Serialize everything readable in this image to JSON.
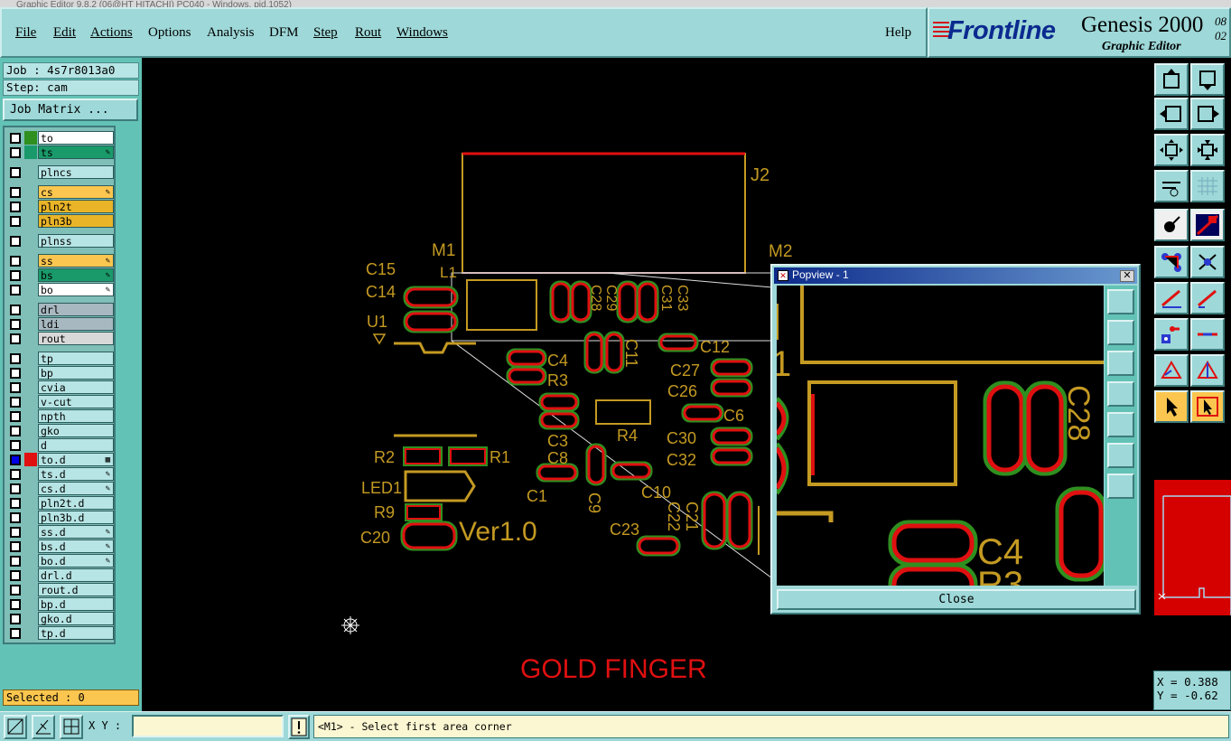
{
  "titlebar": {
    "text": "Graphic Editor 9.8.2 (06@HT HITACHI) PC040 - Windows, pid.1052)"
  },
  "menu": {
    "file": "File",
    "edit": "Edit",
    "actions": "Actions",
    "options": "Options",
    "analysis": "Analysis",
    "dfm": "DFM",
    "step": "Step",
    "rout": "Rout",
    "windows": "Windows",
    "help": "Help"
  },
  "brand": {
    "logo": "Frontline",
    "product": "Genesis 2000",
    "subtitle": "Graphic Editor",
    "version": "08 02"
  },
  "left": {
    "job": "Job : 4s7r8013a0",
    "step": "Step: cam",
    "job_matrix": "Job Matrix ...",
    "selected": "Selected : 0"
  },
  "layers": [
    {
      "name": "to",
      "color": "#2f8f1f",
      "bg": "#ffffff",
      "flag": ""
    },
    {
      "name": "ts",
      "color": "#1a9a6a",
      "bg": "#1a9a6a",
      "flag": "✎"
    },
    {
      "name": "plncs",
      "color": "",
      "bg": "#b7e4e4",
      "flag": ""
    },
    {
      "name": "cs",
      "color": "",
      "bg": "#fbc64f",
      "flag": "✎"
    },
    {
      "name": "pln2t",
      "color": "",
      "bg": "#e9b428",
      "flag": ""
    },
    {
      "name": "pln3b",
      "color": "",
      "bg": "#e9b428",
      "flag": ""
    },
    {
      "name": "plnss",
      "color": "",
      "bg": "#b7e4e4",
      "flag": ""
    },
    {
      "name": "ss",
      "color": "",
      "bg": "#fbc64f",
      "flag": "✎"
    },
    {
      "name": "bs",
      "color": "",
      "bg": "#1a9a6a",
      "flag": "✎"
    },
    {
      "name": "bo",
      "color": "",
      "bg": "#ffffff",
      "flag": "✎"
    },
    {
      "name": "drl",
      "color": "",
      "bg": "#a8b8c0",
      "flag": ""
    },
    {
      "name": "ldi",
      "color": "",
      "bg": "#a8b8c0",
      "flag": ""
    },
    {
      "name": "rout",
      "color": "",
      "bg": "#d8d8d8",
      "flag": ""
    },
    {
      "name": "tp",
      "color": "",
      "bg": "#b7e4e4",
      "flag": ""
    },
    {
      "name": "bp",
      "color": "",
      "bg": "#b7e4e4",
      "flag": ""
    },
    {
      "name": "cvia",
      "color": "",
      "bg": "#b7e4e4",
      "flag": ""
    },
    {
      "name": "v-cut",
      "color": "",
      "bg": "#b7e4e4",
      "flag": ""
    },
    {
      "name": "npth",
      "color": "",
      "bg": "#b7e4e4",
      "flag": ""
    },
    {
      "name": "gko",
      "color": "",
      "bg": "#b7e4e4",
      "flag": ""
    },
    {
      "name": "d",
      "color": "",
      "bg": "#b7e4e4",
      "flag": ""
    },
    {
      "name": "to.d",
      "color": "#e01010",
      "bg": "#b7e4e4",
      "flag": "▦"
    },
    {
      "name": "ts.d",
      "color": "",
      "bg": "#b7e4e4",
      "flag": "✎"
    },
    {
      "name": "cs.d",
      "color": "",
      "bg": "#b7e4e4",
      "flag": "✎"
    },
    {
      "name": "pln2t.d",
      "color": "",
      "bg": "#b7e4e4",
      "flag": ""
    },
    {
      "name": "pln3b.d",
      "color": "",
      "bg": "#b7e4e4",
      "flag": ""
    },
    {
      "name": "ss.d",
      "color": "",
      "bg": "#b7e4e4",
      "flag": "✎"
    },
    {
      "name": "bs.d",
      "color": "",
      "bg": "#b7e4e4",
      "flag": "✎"
    },
    {
      "name": "bo.d",
      "color": "",
      "bg": "#b7e4e4",
      "flag": "✎"
    },
    {
      "name": "drl.d",
      "color": "",
      "bg": "#b7e4e4",
      "flag": ""
    },
    {
      "name": "rout.d",
      "color": "",
      "bg": "#b7e4e4",
      "flag": ""
    },
    {
      "name": "bp.d",
      "color": "",
      "bg": "#b7e4e4",
      "flag": ""
    },
    {
      "name": "gko.d",
      "color": "",
      "bg": "#b7e4e4",
      "flag": ""
    },
    {
      "name": "tp.d",
      "color": "",
      "bg": "#b7e4e4",
      "flag": ""
    }
  ],
  "board": {
    "labels": {
      "j2": "J2",
      "m1": "M1",
      "m2": "M2",
      "l1": "L1",
      "c15": "C15",
      "c14": "C14",
      "u1": "U1",
      "c4": "C4",
      "r3": "R3",
      "c3": "C3",
      "c8": "C8",
      "r4": "R4",
      "c1": "C1",
      "c9": "C9",
      "c10": "C10",
      "c12": "C12",
      "c27": "C27",
      "c26": "C26",
      "c6": "C6",
      "c30": "C30",
      "c32": "C32",
      "c23": "C23",
      "c22": "C22",
      "c21": "C21",
      "c11": "C11",
      "c28": "C28",
      "c29": "C29",
      "c31": "C31",
      "c33": "C33",
      "r2": "R2",
      "r1": "R1",
      "led1": "LED1",
      "r9": "R9",
      "c20": "C20",
      "ver": "Ver1.0",
      "gold_finger": "GOLD FINGER"
    }
  },
  "popview": {
    "title": "Popview - 1",
    "close": "Close",
    "labels": {
      "c4": "C4",
      "r3": "R3",
      "c28": "C28"
    }
  },
  "coords": {
    "x": "X = 0.388",
    "y": "Y = -0.62"
  },
  "status": {
    "xy_label": "X Y :",
    "xy_value": "",
    "prompt": "<M1> - Select first area corner"
  },
  "colors": {
    "panel": "#9ed8d8",
    "panel_dark": "#63c2b6",
    "silk": "#c49a22",
    "copper": "#e01010",
    "mask": "#2f8f1f",
    "selected": "#fbc64f"
  }
}
